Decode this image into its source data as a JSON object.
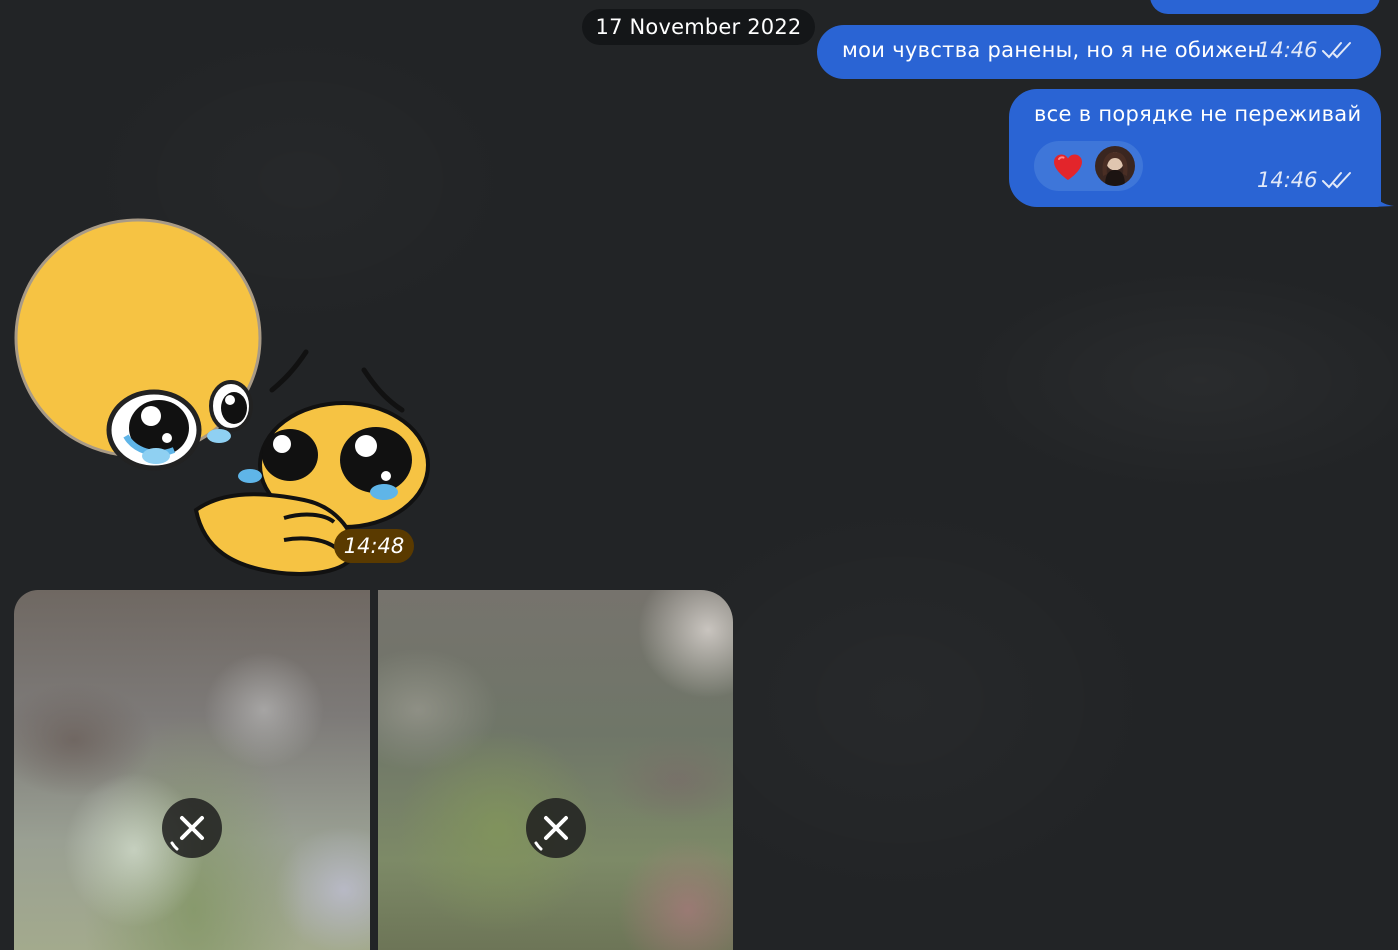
{
  "date_separator": "17 November 2022",
  "messages": [
    {
      "text": "мои чувства ранены, но я не обижен",
      "time": "14:46",
      "status_icon": "double-check-icon"
    },
    {
      "text": "все в порядке не переживай",
      "time": "14:46",
      "status_icon": "double-check-icon",
      "reactions": [
        {
          "emoji_icon": "red-heart-icon",
          "reactor_icon": "user-avatar"
        }
      ]
    }
  ],
  "sticker": {
    "time": "14:48",
    "icon": "crying-emoji-hug-sticker"
  },
  "media_album": {
    "items": [
      {
        "state": "loading",
        "icon": "cancel-download-icon"
      },
      {
        "state": "loading",
        "icon": "cancel-download-icon"
      }
    ]
  },
  "colors": {
    "outgoing_bubble": "#2a64d4",
    "background": "#222426",
    "date_chip": "#141618",
    "sticker_time_badge": "#5a3a00"
  }
}
